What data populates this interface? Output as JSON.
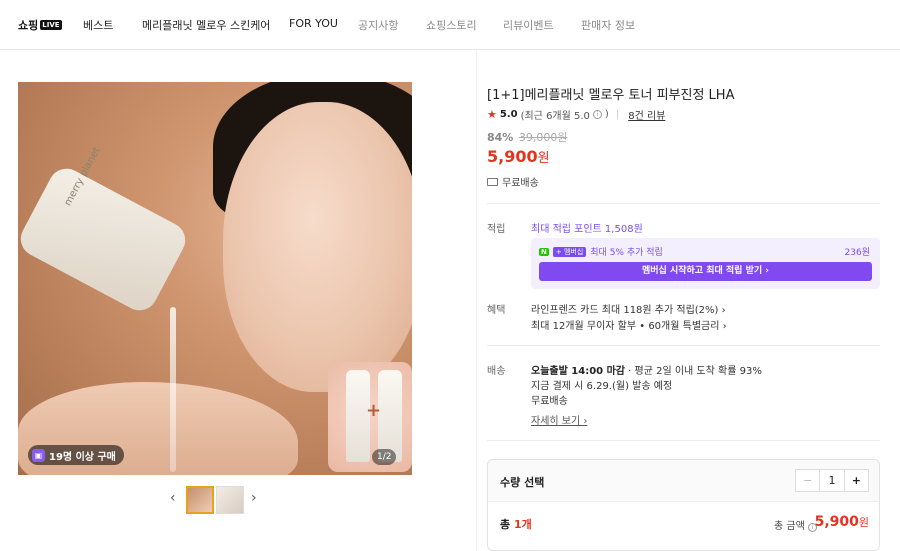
{
  "nav": {
    "logo": "쇼핑",
    "logo_badge": "LIVE",
    "items": [
      "베스트",
      "메리플래닛 멜로우 스킨케어",
      "FOR YOU",
      "공지사항",
      "쇼핑스토리",
      "리뷰이벤트",
      "판매자 정보"
    ]
  },
  "gallery": {
    "bottle_text": "merry planet",
    "buyers_badge": "19명 이상 구매",
    "page_indicator": "1/2",
    "prev_arrow": "‹",
    "next_arrow": "›"
  },
  "product": {
    "title": "[1+1]메리플래닛 멜로우 토너 피부진정 LHA",
    "rating_score": "5.0",
    "rating_detail": "(최근 6개월 5.0",
    "rating_close": ")",
    "review_count": "8건 리뷰",
    "discount_pct": "84%",
    "original_price": "39,000원",
    "price": "5,900",
    "price_unit": "원",
    "shipping": "무료배송"
  },
  "points": {
    "label": "적립",
    "max_point": "최대 적립 포인트 1,508원",
    "member_badge_n": "N",
    "member_badge_plus": "+ 멤버십",
    "member_rate": "최대 5% 추가 적립",
    "member_amount": "236원",
    "member_cta": "멤버십 시작하고 최대 적립 받기 ›"
  },
  "benefits": {
    "label": "혜택",
    "line1": "라인프렌즈 카드 최대 118원 추가 적립(2%) ›",
    "line2": "최대 12개월 무이자 할부 • 60개월 특별금리 ›"
  },
  "delivery": {
    "label": "배송",
    "bold": "오늘출발 14:00 마감",
    "rest": " · 평균 2일 이내 도착 확률 93%",
    "line2": "지금 결제 시 6.29.(월) 발송 예정",
    "line3": "무료배송",
    "detail_link": "자세히 보기 ›"
  },
  "order": {
    "qty_label": "수량 선택",
    "minus": "−",
    "qty": "1",
    "plus": "+",
    "total_prefix": "총 ",
    "total_count": "1개",
    "total_label": "총 금액",
    "total_price": "5,900",
    "total_unit": "원"
  },
  "colors": {
    "accent_red": "#e4331f",
    "purple": "#8149f0",
    "npay_green": "#1ec800"
  }
}
